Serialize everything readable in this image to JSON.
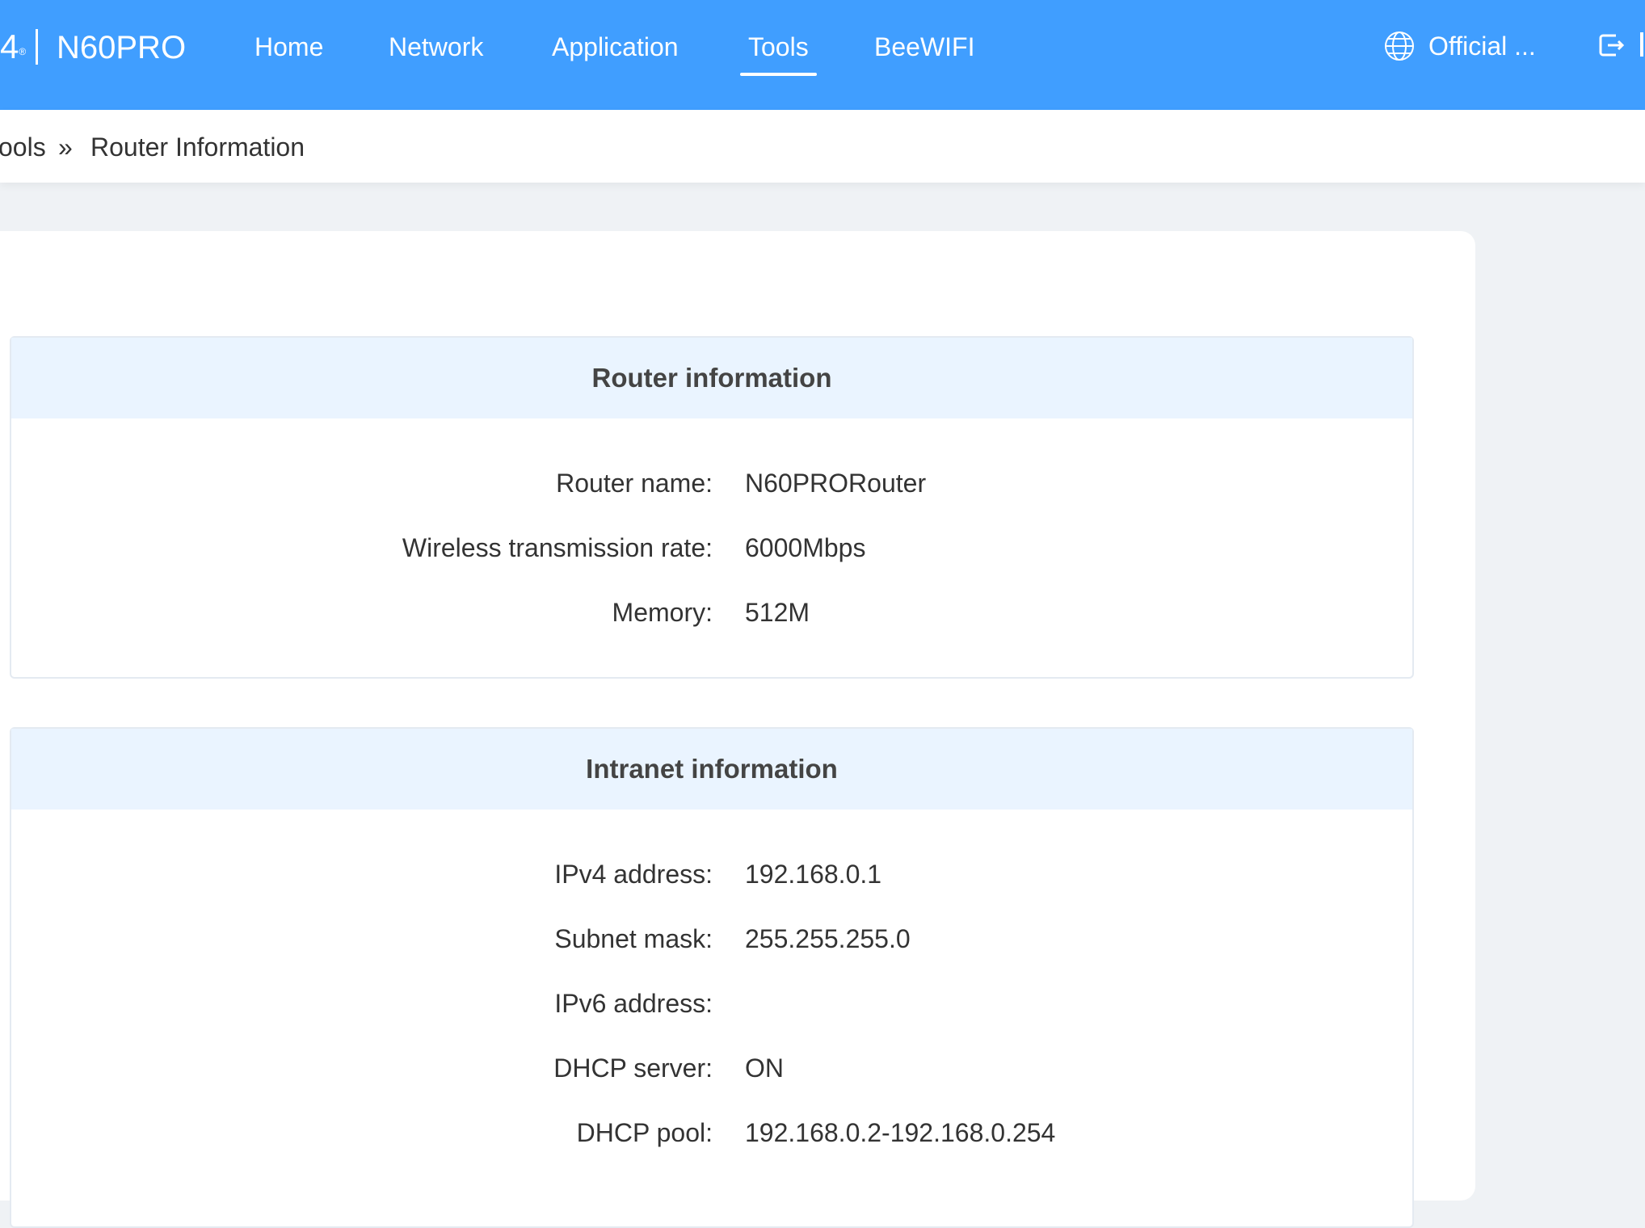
{
  "header": {
    "logo_text": "4",
    "logo_mark": "®",
    "model": "N60PRO",
    "nav": [
      "Home",
      "Network",
      "Application",
      "Tools",
      "BeeWIFI"
    ],
    "active_nav": "Tools",
    "official_label": "Official ...",
    "accent_color": "#409eff"
  },
  "breadcrumb": {
    "parent": "ools",
    "separator": "»",
    "current": "Router Information"
  },
  "router_info": {
    "title": "Router information",
    "rows": [
      {
        "label": "Router name:",
        "value": "N60PRORouter"
      },
      {
        "label": "Wireless transmission rate:",
        "value": "6000Mbps"
      },
      {
        "label": "Memory:",
        "value": "512M"
      }
    ]
  },
  "intranet_info": {
    "title": "Intranet information",
    "rows": [
      {
        "label": "IPv4 address:",
        "value": "192.168.0.1"
      },
      {
        "label": "Subnet mask:",
        "value": "255.255.255.0"
      },
      {
        "label": "IPv6 address:",
        "value": ""
      },
      {
        "label": "DHCP server:",
        "value": "ON"
      },
      {
        "label": "DHCP pool:",
        "value": "192.168.0.2-192.168.0.254"
      }
    ]
  },
  "icons": {
    "official": "globe-icon",
    "logout": "logout-icon"
  }
}
